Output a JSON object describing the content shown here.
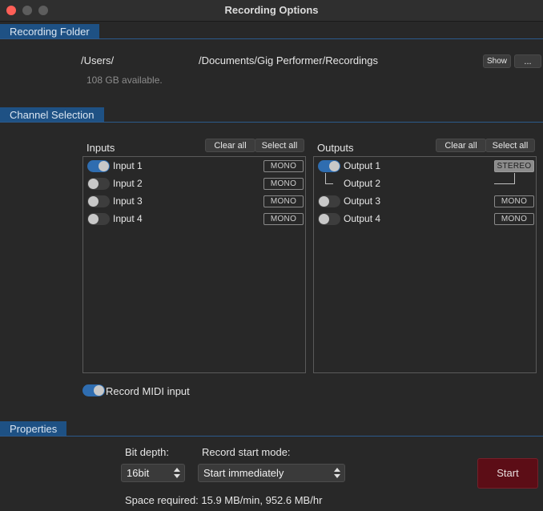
{
  "window": {
    "title": "Recording Options"
  },
  "folder": {
    "header": "Recording Folder",
    "path_prefix": "/Users/",
    "path_suffix": "/Documents/Gig Performer/Recordings",
    "available": "108 GB available.",
    "show_label": "Show",
    "browse_label": "..."
  },
  "channels": {
    "header": "Channel Selection",
    "inputs": {
      "title": "Inputs",
      "clear_label": "Clear all",
      "select_label": "Select all",
      "items": [
        {
          "name": "Input 1",
          "mode": "MONO",
          "enabled": true
        },
        {
          "name": "Input 2",
          "mode": "MONO",
          "enabled": false
        },
        {
          "name": "Input 3",
          "mode": "MONO",
          "enabled": false
        },
        {
          "name": "Input 4",
          "mode": "MONO",
          "enabled": false
        }
      ]
    },
    "outputs": {
      "title": "Outputs",
      "clear_label": "Clear all",
      "select_label": "Select all",
      "items": [
        {
          "name": "Output 1",
          "mode": "STEREO",
          "enabled": true
        },
        {
          "name": "Output 2"
        },
        {
          "name": "Output 3",
          "mode": "MONO",
          "enabled": false
        },
        {
          "name": "Output 4",
          "mode": "MONO",
          "enabled": false
        }
      ]
    },
    "midi_label": "Record MIDI input",
    "midi_enabled": true
  },
  "properties": {
    "header": "Properties",
    "bit_depth_label": "Bit depth:",
    "bit_depth_value": "16bit",
    "start_mode_label": "Record start mode:",
    "start_mode_value": "Start immediately",
    "space_required": "Space required: 15.9 MB/min, 952.6 MB/hr",
    "start_label": "Start"
  },
  "colors": {
    "section": "#1e5184",
    "toggle_on": "#2f6db0",
    "start": "#5c0d16",
    "close": "#ff5f57"
  }
}
